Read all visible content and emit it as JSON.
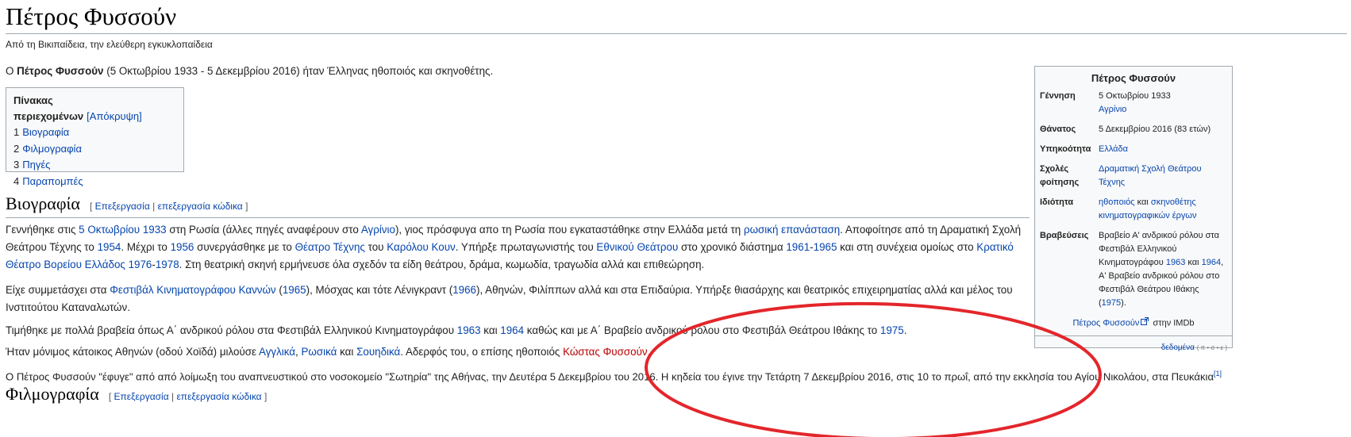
{
  "title": "Πέτρος Φυσσούν",
  "tagline": "Από τη Βικιπαίδεια, την ελεύθερη εγκυκλοπαίδεια",
  "lead": {
    "prefix": "Ο ",
    "name_bold": "Πέτρος Φυσσούν",
    "rest": " (5 Οκτωβρίου 1933 - 5 Δεκεμβρίου 2016) ήταν Έλληνας ηθοποιός και σκηνοθέτης."
  },
  "toc": {
    "heading": "Πίνακας περιεχομένων",
    "toggle": "[Απόκρυψη]",
    "items": [
      {
        "num": "1",
        "label": "Βιογραφία"
      },
      {
        "num": "2",
        "label": "Φιλμογραφία"
      },
      {
        "num": "3",
        "label": "Πηγές"
      },
      {
        "num": "4",
        "label": "Παραπομπές"
      }
    ]
  },
  "sections": {
    "bio": {
      "title": "Βιογραφία",
      "edit_open": "[ ",
      "edit_link": "Επεξεργασία",
      "edit_sep": " | ",
      "edit_code": "επεξεργασία κώδικα",
      "edit_close": " ]"
    },
    "film": {
      "title": "Φιλμογραφία",
      "edit_open": "[ ",
      "edit_link": "Επεξεργασία",
      "edit_sep": " | ",
      "edit_code": "επεξεργασία κώδικα",
      "edit_close": " ]"
    }
  },
  "bio_paragraphs": {
    "p1": {
      "t1": "Γεννήθηκε στις ",
      "l1": "5 Οκτωβρίου",
      "t2": " ",
      "l2": "1933",
      "t3": " στη Ρωσία (άλλες πηγές αναφέρουν στο ",
      "l3": "Αγρίνιο",
      "t4": "), γιος πρόσφυγα απο τη Ρωσία που εγκαταστάθηκε στην Ελλάδα μετά τη ",
      "l4": "ρωσική επανάσταση",
      "t5": ". Αποφοίτησε από τη Δραματική Σχολή",
      "t6": "Θεάτρου Τέχνης το ",
      "l5": "1954",
      "t7": ". Μέχρι το ",
      "l6": "1956",
      "t8": " συνεργάσθηκε με το ",
      "l7": "Θέατρο Τέχνης",
      "t9": " του ",
      "l8": "Καρόλου Κουν",
      "t10": ". Υπήρξε πρωταγωνιστής του ",
      "l9": "Εθνικού Θεάτρου",
      "t11": " στο χρονικό διάστημα ",
      "l10": "1961",
      "t12": "-",
      "l11": "1965",
      "t13": " και στη συνέχεια ομοίως στο ",
      "l12": "Κρατικό",
      "l13": "Θέατρο Βορείου Ελλάδος",
      "t14": " ",
      "l14": "1976",
      "t15": "-",
      "l15": "1978",
      "t16": ". Στη θεατρική σκηνή ερμήνευσε όλα σχεδόν τα είδη θεάτρου, δράμα, κωμωδία, τραγωδία αλλά και επιθεώρηση."
    },
    "p2": {
      "t1": "Είχε συμμετάσχει στα ",
      "l1": "Φεστιβάλ Κινηματογράφου Καννών",
      "t2": " (",
      "l2": "1965",
      "t3": "), Μόσχας και τότε Λένιγκραντ (",
      "l3": "1966",
      "t4": "), Αθηνών, Φιλίππων αλλά και στα Επιδαύρια. Υπήρξε θιασάρχης και θεατρικός επιχειρηματίας αλλά και μέλος του",
      "t5": "Ινστιτούτου Καταναλωτών."
    },
    "p3": {
      "t1": "Τιμήθηκε με πολλά βραβεία όπως Α΄ ανδρικού ρόλου στα Φεστιβάλ Ελληνικού Κινηματογράφου ",
      "l1": "1963",
      "t2": " και ",
      "l2": "1964",
      "t3": " καθώς και με Α΄ Βραβείο ανδρικού ρόλου στο Φεστιβάλ Θεάτρου Ιθάκης το ",
      "l3": "1975",
      "t4": "."
    },
    "p4": {
      "t1": "Ήταν μόνιμος κάτοικος Αθηνών (οδού Χοϊδά) μιλούσε ",
      "l1": "Αγγλικά",
      "t2": ", ",
      "l2": "Ρωσικά",
      "t3": " και ",
      "l3": "Σουηδικά",
      "t4": ". Αδερφός του, ο επίσης ηθοποιός ",
      "l4": "Κώστας Φυσσούν",
      "t5": "."
    },
    "p5": {
      "t1": "Ο Πέτρος Φυσσούν \"έφυγε\" από από λοίμωξη του αναπνευστικού στο νοσοκομείο \"Σωτηρία\" της Αθήνας, την Δευτέρα 5 Δεκεμβρίου του 2016. Η κηδεία του έγινε την Τετάρτη 7 Δεκεμβρίου 2016, στις 10 το πρωΐ, από την εκκλησία του Αγίου Νικολάου, στα Πευκάκια",
      "ref": "[1]"
    }
  },
  "infobox": {
    "title": "Πέτρος Φυσσούν",
    "birth_label": "Γέννηση",
    "birth_date": "5 Οκτωβρίου 1933",
    "birth_place": "Αγρίνιο",
    "death_label": "Θάνατος",
    "death_value": "5 Δεκεμβρίου 2016 (83 ετών)",
    "citizenship_label": "Υπηκοότητα",
    "citizenship_value": "Ελλάδα",
    "school_label": "Σχολές φοίτησης",
    "school_value": "Δραματική Σχολή Θεάτρου Τέχνης",
    "occupation_label": "Ιδιότητα",
    "occupation_l1": "ηθοποιός",
    "occupation_and": " και ",
    "occupation_l2": "σκηνοθέτης κινηματογραφικών έργων",
    "awards_label": "Βραβεύσεις",
    "awards_t1": "Βραβείο Α' ανδρικού ρόλου στα Φεστιβάλ Ελληνικού Κινηματογράφου ",
    "awards_l1": "1963",
    "awards_t2": " και ",
    "awards_l2": "1964",
    "awards_t3": ", Α' Βραβείο ανδρικού ρόλου στο Φεστιβάλ Θεάτρου Ιθάκης (",
    "awards_l3": "1975",
    "awards_t4": ").",
    "imdb_link": "Πέτρος Φυσσούν",
    "imdb_text": " στην IMDb",
    "wikidata": "δεδομένα",
    "wikidata_tiny": "( π • σ • ε )"
  },
  "colors": {
    "link": "#0645ad",
    "redlink": "#ba0000",
    "annotation": "#e3262b"
  },
  "icons": {
    "external": "external-link-icon"
  }
}
